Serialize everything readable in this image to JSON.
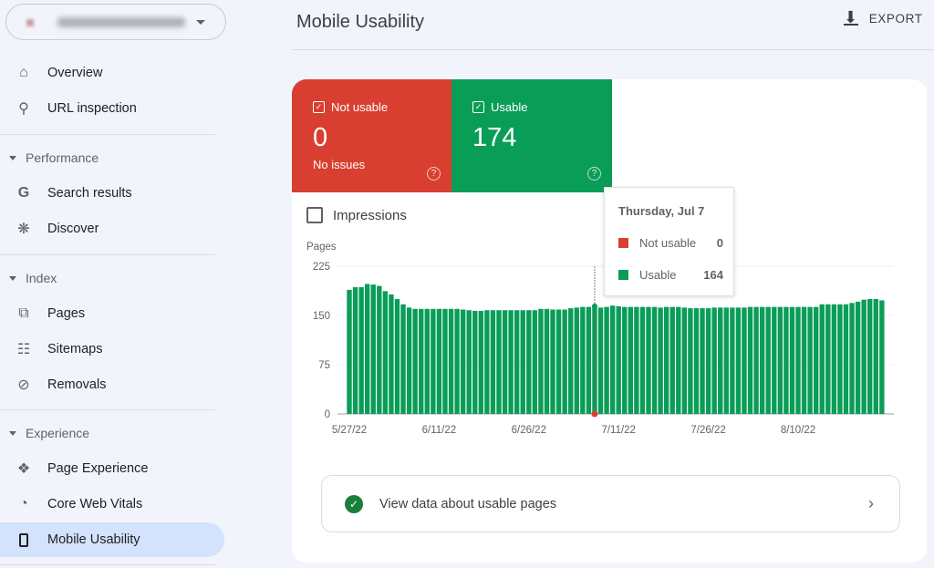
{
  "sidebar": {
    "property_selector": {
      "icon": "chevron-down-icon"
    },
    "items_top": [
      {
        "label": "Overview",
        "icon": "home-icon"
      },
      {
        "label": "URL inspection",
        "icon": "search-icon"
      }
    ],
    "sections": [
      {
        "label": "Performance",
        "items": [
          {
            "label": "Search results",
            "icon": "google-icon"
          },
          {
            "label": "Discover",
            "icon": "asterisk-icon"
          }
        ]
      },
      {
        "label": "Index",
        "items": [
          {
            "label": "Pages",
            "icon": "pages-icon"
          },
          {
            "label": "Sitemaps",
            "icon": "sitemap-icon"
          },
          {
            "label": "Removals",
            "icon": "eye-off-icon"
          }
        ]
      },
      {
        "label": "Experience",
        "items": [
          {
            "label": "Page Experience",
            "icon": "page-experience-icon"
          },
          {
            "label": "Core Web Vitals",
            "icon": "gauge-icon"
          },
          {
            "label": "Mobile Usability",
            "icon": "phone-icon",
            "active": true
          }
        ]
      }
    ]
  },
  "header": {
    "title": "Mobile Usability",
    "export_label": "EXPORT"
  },
  "summary": {
    "not_usable": {
      "label": "Not usable",
      "value": "0",
      "sub": "No issues",
      "color": "#d93f30"
    },
    "usable": {
      "label": "Usable",
      "value": "174",
      "color": "#0a9d58"
    }
  },
  "impressions_label": "Impressions",
  "tooltip": {
    "date": "Thursday, Jul 7",
    "rows": [
      {
        "label": "Not usable",
        "value": "0"
      },
      {
        "label": "Usable",
        "value": "164"
      }
    ]
  },
  "usable_link": "View data about usable pages",
  "chart_data": {
    "type": "bar",
    "ylabel": "Pages",
    "ylim": [
      0,
      225
    ],
    "yticks": [
      "0",
      "75",
      "150",
      "225"
    ],
    "xtick_labels": [
      "5/27/22",
      "6/11/22",
      "6/26/22",
      "7/11/22",
      "7/26/22",
      "8/10/22"
    ],
    "xtick_index": [
      0,
      15,
      30,
      45,
      60,
      75
    ],
    "start_date": "5/27/22",
    "grid": true,
    "highlight_index": 41,
    "series": [
      {
        "name": "Usable",
        "color": "#0a9d58",
        "values": [
          189,
          193,
          193,
          198,
          197,
          195,
          187,
          182,
          175,
          167,
          162,
          160,
          160,
          160,
          160,
          160,
          160,
          160,
          160,
          159,
          158,
          157,
          157,
          158,
          158,
          158,
          158,
          158,
          158,
          158,
          158,
          158,
          160,
          160,
          159,
          159,
          159,
          161,
          162,
          163,
          163,
          164,
          162,
          163,
          165,
          164,
          163,
          163,
          163,
          163,
          163,
          163,
          162,
          163,
          163,
          163,
          162,
          161,
          161,
          161,
          161,
          162,
          162,
          162,
          162,
          162,
          162,
          163,
          163,
          163,
          163,
          163,
          163,
          163,
          163,
          163,
          163,
          163,
          163,
          167,
          167,
          167,
          167,
          167,
          169,
          171,
          174,
          175,
          175,
          173
        ]
      },
      {
        "name": "Not usable",
        "color": "#d93f30",
        "values": []
      }
    ]
  }
}
